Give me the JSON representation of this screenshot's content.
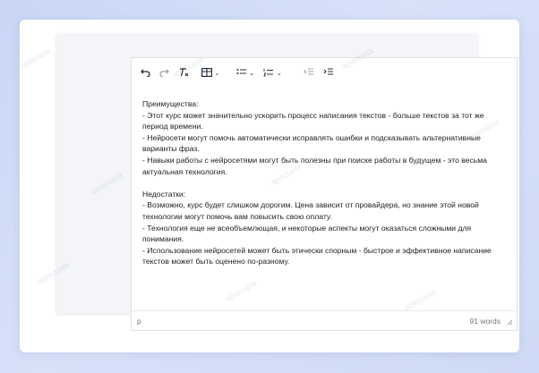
{
  "editor": {
    "toolbar": [
      {
        "name": "undo-icon"
      },
      {
        "name": "redo-icon"
      },
      {
        "name": "clear-formatting-icon"
      },
      {
        "name": "table-icon"
      },
      {
        "name": "bullet-list-icon"
      },
      {
        "name": "numbered-list-icon"
      },
      {
        "name": "outdent-icon"
      },
      {
        "name": "indent-icon"
      }
    ],
    "content": {
      "pros_title": "Преимущества:",
      "pros": [
        "- Этот курс может значительно ускорить процесс написания текстов - больше текстов за тот же период времени.",
        "- Нейросети могут помочь автоматически исправлять ошибки и подсказывать альтернативные варианты фраз.",
        "- Навыки работы с нейросетями могут быть полезны при поиске работы в будущем - это весьма актуальная технология."
      ],
      "cons_title": "Недостатки:",
      "cons": [
        "- Возможно, курс будет слишком дорогим. Цена зависит от провайдера, но знание этой новой технологии могут помочь вам повысить свою оплату.",
        "- Технология еще не всеобъемлющая, и некоторые аспекты могут оказаться сложными для понимания.",
        "- Использование нейросетей может быть этически спорным - быстрое и эффективное написание текстов может быть оценено по-разному."
      ]
    },
    "status": {
      "path": "p",
      "word_count": "91 words"
    }
  },
  "watermark": "apiscupta"
}
